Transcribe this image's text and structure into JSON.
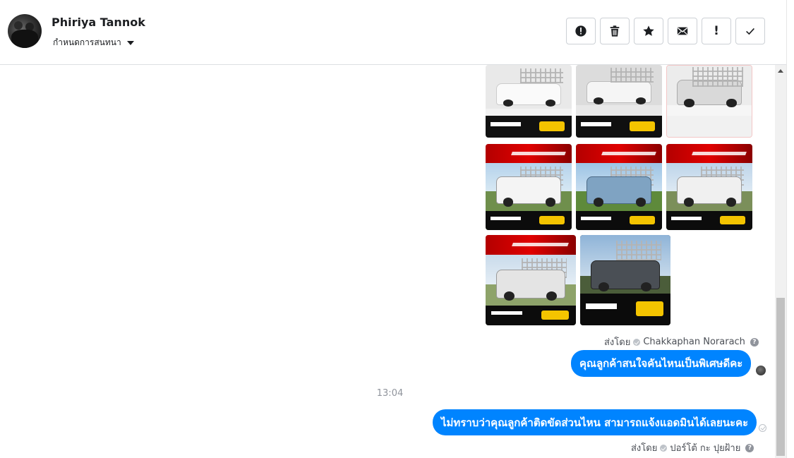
{
  "header": {
    "contact_name": "Phiriya Tannok",
    "settings_label": "กำหนดการสนทนา",
    "toolbar": [
      {
        "name": "report-spam-button",
        "icon": "alert-circle-icon"
      },
      {
        "name": "delete-button",
        "icon": "trash-icon"
      },
      {
        "name": "star-button",
        "icon": "star-icon"
      },
      {
        "name": "mark-unread-button",
        "icon": "envelope-icon"
      },
      {
        "name": "mark-important-button",
        "icon": "exclamation-icon",
        "glyph": "!"
      },
      {
        "name": "mark-done-button",
        "icon": "check-icon",
        "glyph": "✓"
      }
    ]
  },
  "messages": {
    "sender_prefix": "ส่งโดย",
    "first_sender": "Chakkaphan Norarach",
    "bubble_1": "คุณลูกค้าสนใจคันไหนเป็นพิเศษดีคะ",
    "timestamp": "13:04",
    "bubble_2": "ไม่ทราบว่าคุณลูกค้าติดขัดส่วนไหน สามารถแจ้งแอดมินได้เลยนะคะ",
    "second_sender": "ปอร์โต้ กะ ปุยฝ้าย",
    "help_glyph": "?"
  },
  "colors": {
    "bubble": "#0084ff",
    "banner_red": "#d00000",
    "footer_dark": "#0c0c0c",
    "price_yellow": "#f4c400"
  }
}
